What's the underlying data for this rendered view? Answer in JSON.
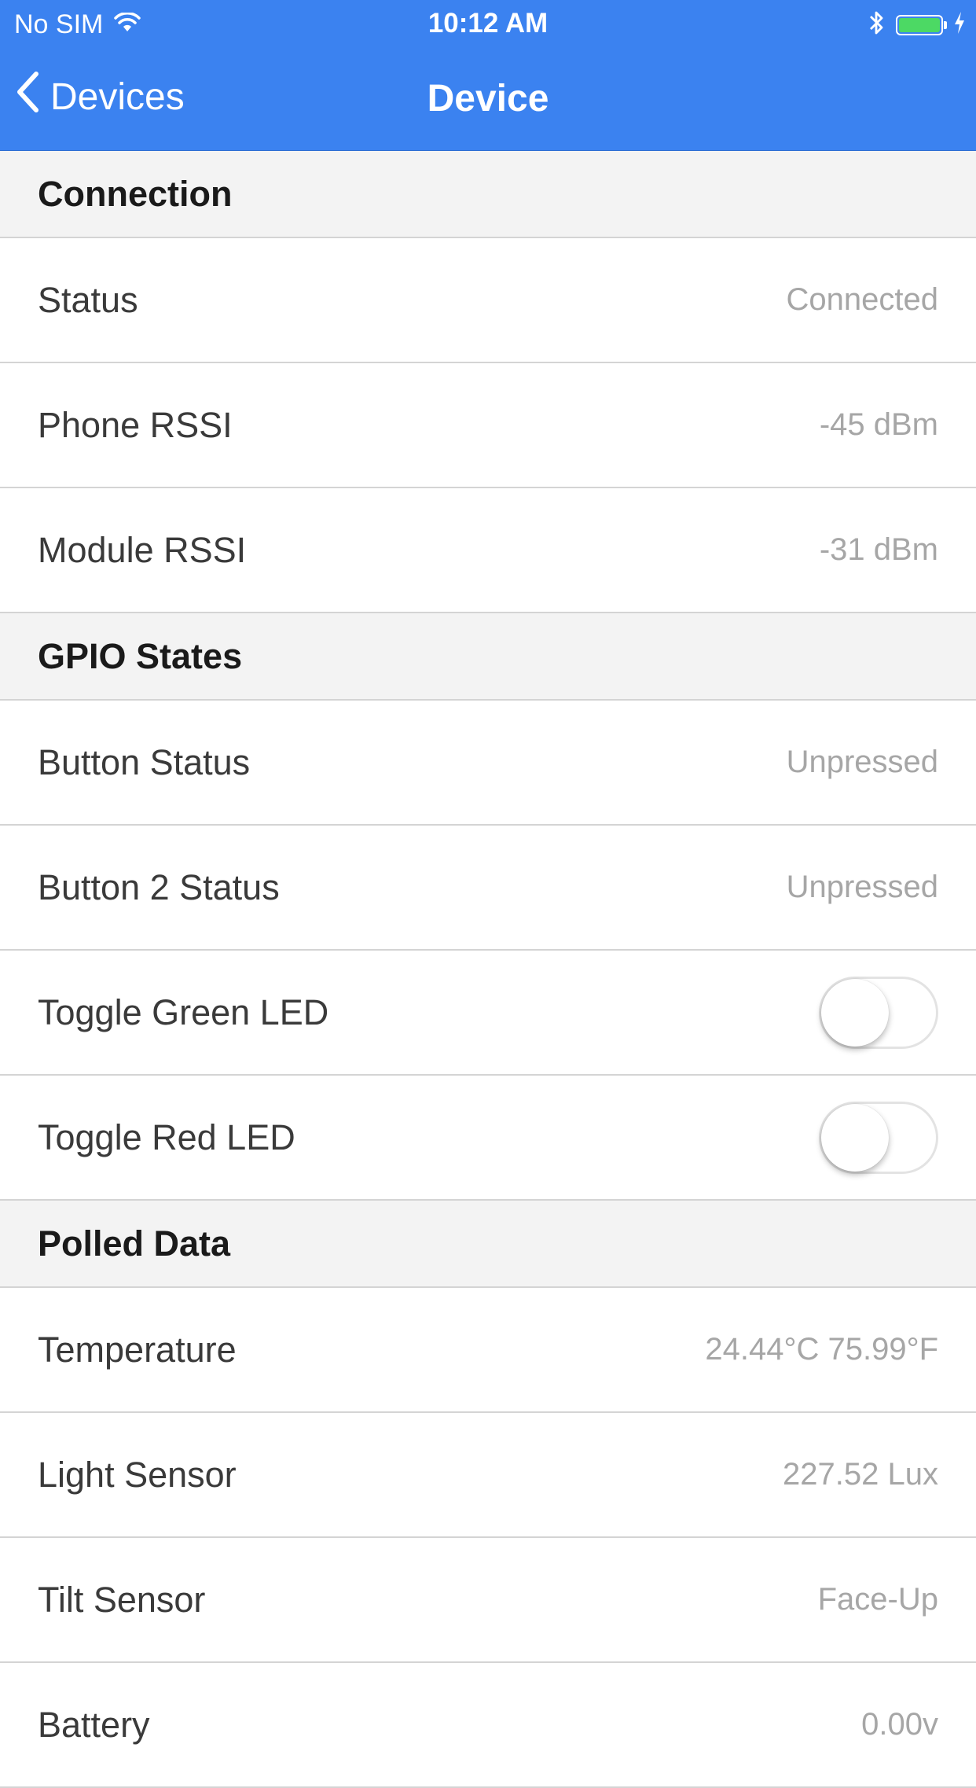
{
  "status_bar": {
    "carrier": "No SIM",
    "time": "10:12 AM",
    "wifi_icon": "wifi-icon",
    "bluetooth_icon": "bluetooth-icon",
    "battery_icon": "battery-icon",
    "charging_icon": "bolt-icon"
  },
  "nav": {
    "back_label": "Devices",
    "title": "Device",
    "back_icon": "chevron-left-icon"
  },
  "colors": {
    "nav_background": "#3b82f0",
    "section_background": "#f3f3f3",
    "value_text": "#a6a6a6",
    "battery_fill": "#4cd964"
  },
  "sections": {
    "connection": {
      "title": "Connection",
      "rows": [
        {
          "label": "Status",
          "value": "Connected"
        },
        {
          "label": "Phone RSSI",
          "value": "-45 dBm"
        },
        {
          "label": "Module RSSI",
          "value": "-31 dBm"
        }
      ]
    },
    "gpio": {
      "title": "GPIO States",
      "rows": [
        {
          "label": "Button Status",
          "value": "Unpressed"
        },
        {
          "label": "Button 2 Status",
          "value": "Unpressed"
        },
        {
          "label": "Toggle Green LED",
          "toggle_on": false
        },
        {
          "label": "Toggle Red LED",
          "toggle_on": false
        }
      ]
    },
    "polled": {
      "title": "Polled Data",
      "rows": [
        {
          "label": "Temperature",
          "value": "24.44°C 75.99°F"
        },
        {
          "label": "Light Sensor",
          "value": "227.52 Lux"
        },
        {
          "label": "Tilt Sensor",
          "value": "Face-Up"
        },
        {
          "label": "Battery",
          "value": "0.00v"
        }
      ]
    }
  }
}
